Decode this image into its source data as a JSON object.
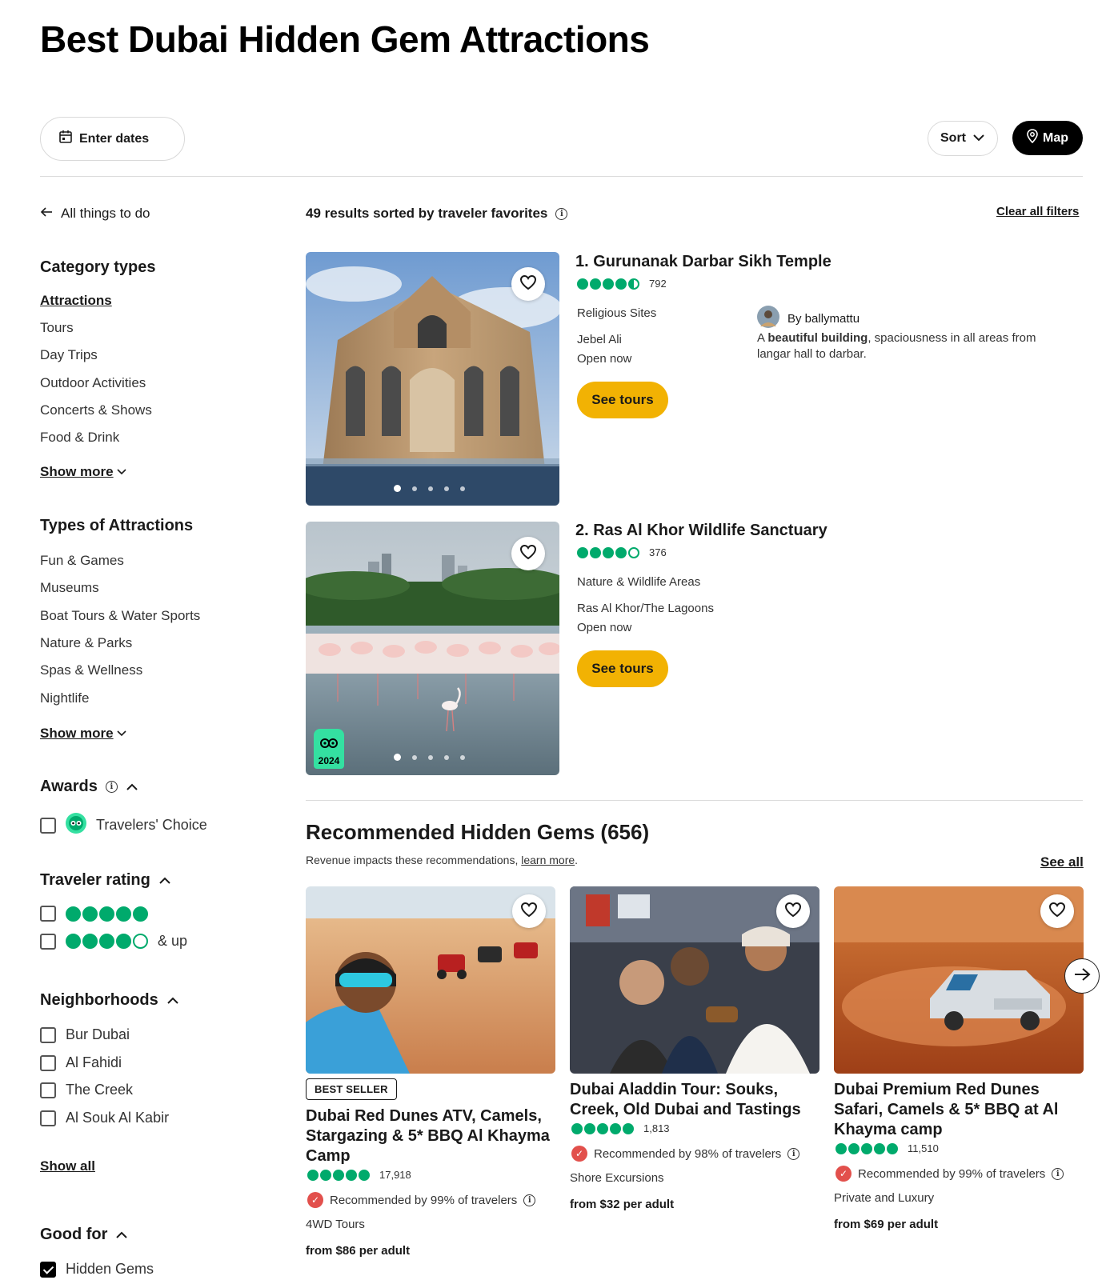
{
  "page": {
    "title": "Best Dubai Hidden Gem Attractions"
  },
  "toolbar": {
    "dates_label": "Enter dates",
    "sort_label": "Sort",
    "map_label": "Map"
  },
  "sidebar": {
    "back_link": "All things to do",
    "category_types": {
      "title": "Category types",
      "items": [
        "Attractions",
        "Tours",
        "Day Trips",
        "Outdoor Activities",
        "Concerts & Shows",
        "Food & Drink"
      ],
      "show_more": "Show more"
    },
    "types_of_attractions": {
      "title": "Types of Attractions",
      "items": [
        "Fun & Games",
        "Museums",
        "Boat Tours & Water Sports",
        "Nature & Parks",
        "Spas & Wellness",
        "Nightlife"
      ],
      "show_more": "Show more"
    },
    "awards": {
      "title": "Awards",
      "option": "Travelers' Choice"
    },
    "traveler_rating": {
      "title": "Traveler rating",
      "options": [
        {
          "bubbles": 5,
          "label": ""
        },
        {
          "bubbles": 4,
          "label": "& up"
        }
      ]
    },
    "neighborhoods": {
      "title": "Neighborhoods",
      "items": [
        "Bur Dubai",
        "Al Fahidi",
        "The Creek",
        "Al Souk Al Kabir"
      ],
      "show_all": "Show all"
    },
    "good_for": {
      "title": "Good for",
      "items": [
        {
          "label": "Hidden Gems",
          "checked": true
        }
      ]
    }
  },
  "results": {
    "summary": "49 results sorted by traveler favorites",
    "clear_filters": "Clear all filters",
    "items": [
      {
        "title": "1. Gurunanak Darbar Sikh Temple",
        "rating": 4.5,
        "reviews": "792",
        "category": "Religious Sites",
        "location": "Jebel Ali",
        "status": "Open now",
        "cta": "See tours",
        "review_author": "By ballymattu",
        "review_bold": "beautiful building",
        "review_prefix": "A",
        "review_rest": ", spaciousness in all areas from langar hall to darbar."
      },
      {
        "title": "2. Ras Al Khor Wildlife Sanctuary",
        "rating": 4,
        "reviews": "376",
        "category": "Nature & Wildlife Areas",
        "location": "Ras Al Khor/The Lagoons",
        "status": "Open now",
        "cta": "See tours",
        "award_year": "2024"
      }
    ]
  },
  "recommended": {
    "title": "Recommended Hidden Gems (656)",
    "subtitle": "Revenue impacts these recommendations,",
    "learn_more": "learn more",
    "see_all": "See all",
    "cards": [
      {
        "badge": "BEST SELLER",
        "title": "Dubai Red Dunes ATV, Camels, Stargazing & 5* BBQ Al Khayma Camp",
        "rating": 5,
        "reviews": "17,918",
        "recommended": "Recommended by 99% of travelers",
        "category": "4WD Tours",
        "price_from": "from",
        "price": "$86",
        "price_unit": "per adult"
      },
      {
        "title": "Dubai Aladdin Tour: Souks, Creek, Old Dubai and Tastings",
        "rating": 5,
        "reviews": "1,813",
        "recommended": "Recommended by 98% of travelers",
        "category": "Shore Excursions",
        "price_from": "from",
        "price": "$32",
        "price_unit": "per adult"
      },
      {
        "title": "Dubai Premium Red Dunes Safari, Camels & 5* BBQ at Al Khayma camp",
        "rating": 5,
        "reviews": "11,510",
        "recommended": "Recommended by 99% of travelers",
        "category": "Private and Luxury",
        "price_from": "from",
        "price": "$69",
        "price_unit": "per adult"
      }
    ]
  },
  "colors": {
    "bubble_green": "#00aa6c",
    "cta_yellow": "#f2b203",
    "recommend_red": "#e2504c"
  }
}
